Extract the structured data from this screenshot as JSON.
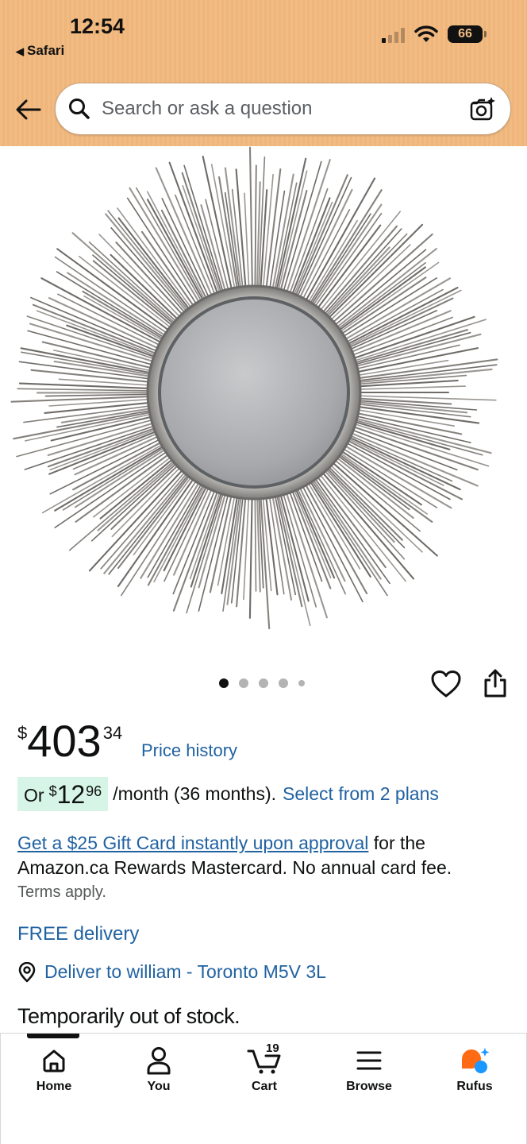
{
  "status_bar": {
    "time": "12:54",
    "back_app": "Safari",
    "battery": "66"
  },
  "header": {
    "search_placeholder": "Search or ask a question"
  },
  "icons": {
    "back": "arrow-left-icon",
    "search": "search-icon",
    "camera": "camera-search-icon",
    "wishlist": "heart-icon",
    "share": "share-icon",
    "location": "location-pin-icon"
  },
  "carousel": {
    "total_images": 5,
    "current_image": 1
  },
  "product": {
    "price": {
      "symbol": "$",
      "whole": "403",
      "fraction": "34"
    },
    "price_history": "Price history",
    "installment": {
      "prefix": "Or",
      "symbol": "$",
      "whole": "12",
      "fraction": "96",
      "term": "/month (36 months).",
      "plans_link": "Select from 2 plans"
    },
    "promo": {
      "link": "Get a $25 Gift Card instantly upon approval",
      "text": " for the Amazon.ca Rewards Mastercard. No annual card fee."
    },
    "terms": "Terms apply.",
    "delivery": "FREE delivery",
    "deliver_to": "Deliver to william - Toronto M5V 3L",
    "stock_status": "Temporarily out of stock."
  },
  "bottom_nav": {
    "items": [
      {
        "label": "Home",
        "icon": "home-icon"
      },
      {
        "label": "You",
        "icon": "user-icon"
      },
      {
        "label": "Cart",
        "icon": "cart-icon",
        "badge": "19"
      },
      {
        "label": "Browse",
        "icon": "menu-icon"
      },
      {
        "label": "Rufus",
        "icon": "rufus-icon"
      }
    ]
  },
  "colors": {
    "header_bg": "#f1bc84",
    "link": "#2162a1",
    "installment_bg": "#d6f5e6",
    "rufus_orange": "#ff6a14",
    "rufus_blue": "#1a98ff"
  }
}
